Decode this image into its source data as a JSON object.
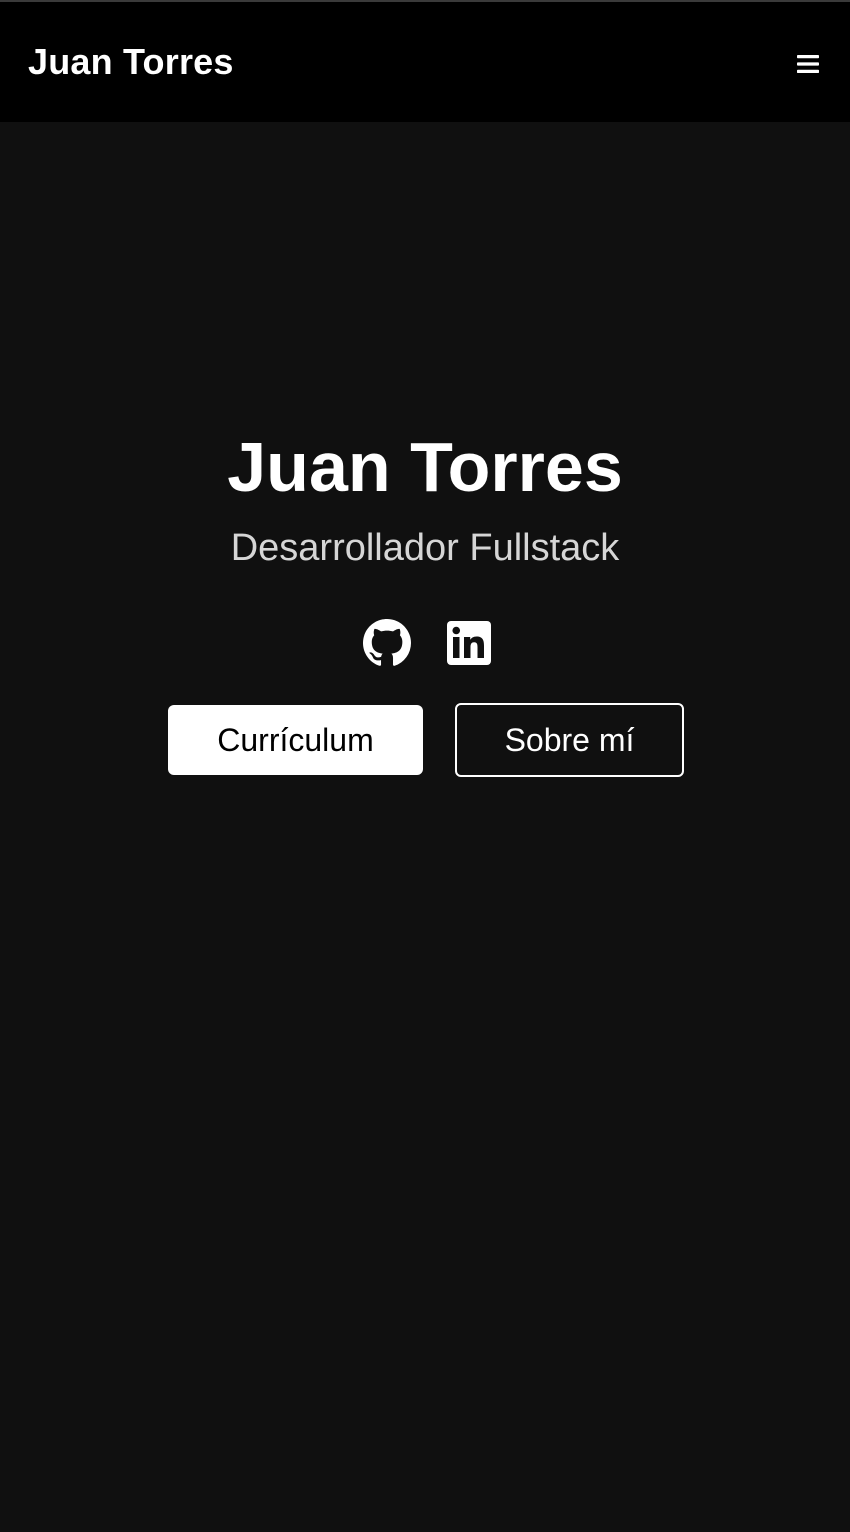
{
  "navbar": {
    "brand": "Juan Torres",
    "menu_icon": "hamburger-menu-icon"
  },
  "hero": {
    "title": "Juan Torres",
    "subtitle": "Desarrollador Fullstack"
  },
  "socials": [
    {
      "icon": "github-icon"
    },
    {
      "icon": "linkedin-icon"
    }
  ],
  "buttons": {
    "resume_label": "Currículum",
    "about_label": "Sobre mí"
  },
  "colors": {
    "page_background": "#101010",
    "navbar_background": "#000000",
    "text_primary": "#ffffff",
    "text_secondary": "#d6d6d6"
  }
}
